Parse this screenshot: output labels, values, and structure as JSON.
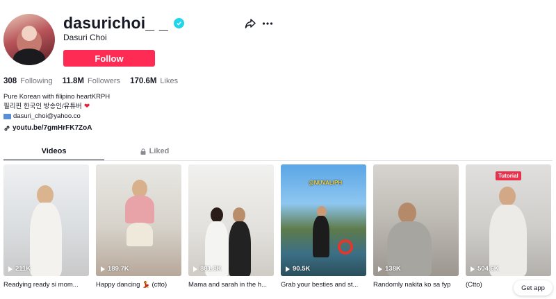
{
  "profile": {
    "username": "dasurichoi_ _",
    "nickname": "Dasuri Choi",
    "follow_label": "Follow"
  },
  "stats": {
    "following": {
      "value": "308",
      "label": "Following"
    },
    "followers": {
      "value": "11.8M",
      "label": "Followers"
    },
    "likes": {
      "value": "170.6M",
      "label": "Likes"
    }
  },
  "bio": {
    "line1": "Pure Korean with filipino heartKRPH",
    "line2": "필리핀 한국인 방송인/유튜버",
    "line3": "dasuri_choi@yahoo.co",
    "link": "youtu.be/7gmHrFK7ZoA"
  },
  "tabs": [
    {
      "label": "Videos",
      "active": true
    },
    {
      "label": "Liked",
      "active": false
    }
  ],
  "videos": [
    {
      "views": "211K",
      "caption": "Readying ready si mom..."
    },
    {
      "views": "189.7K",
      "caption": "Happy dancing 💃 (ctto)"
    },
    {
      "views": "881.8K",
      "caption": "Mama and sarah in the h..."
    },
    {
      "views": "90.5K",
      "caption": "Grab your besties and st...",
      "overlay": "@NUVALIPH"
    },
    {
      "views": "138K",
      "caption": "Randomly nakita ko sa fyp"
    },
    {
      "views": "504.6K",
      "caption": "(Ctto)",
      "overlay": "Tutorial"
    }
  ],
  "get_app_label": "Get app",
  "colors": {
    "accent": "#fe2c55",
    "verified": "#20d5ec",
    "text": "#161823",
    "muted": "#74757b"
  },
  "icons": [
    "verified-icon",
    "share-icon",
    "more-icon",
    "link-icon",
    "mail-icon",
    "heart-icon",
    "lock-icon",
    "play-icon"
  ]
}
